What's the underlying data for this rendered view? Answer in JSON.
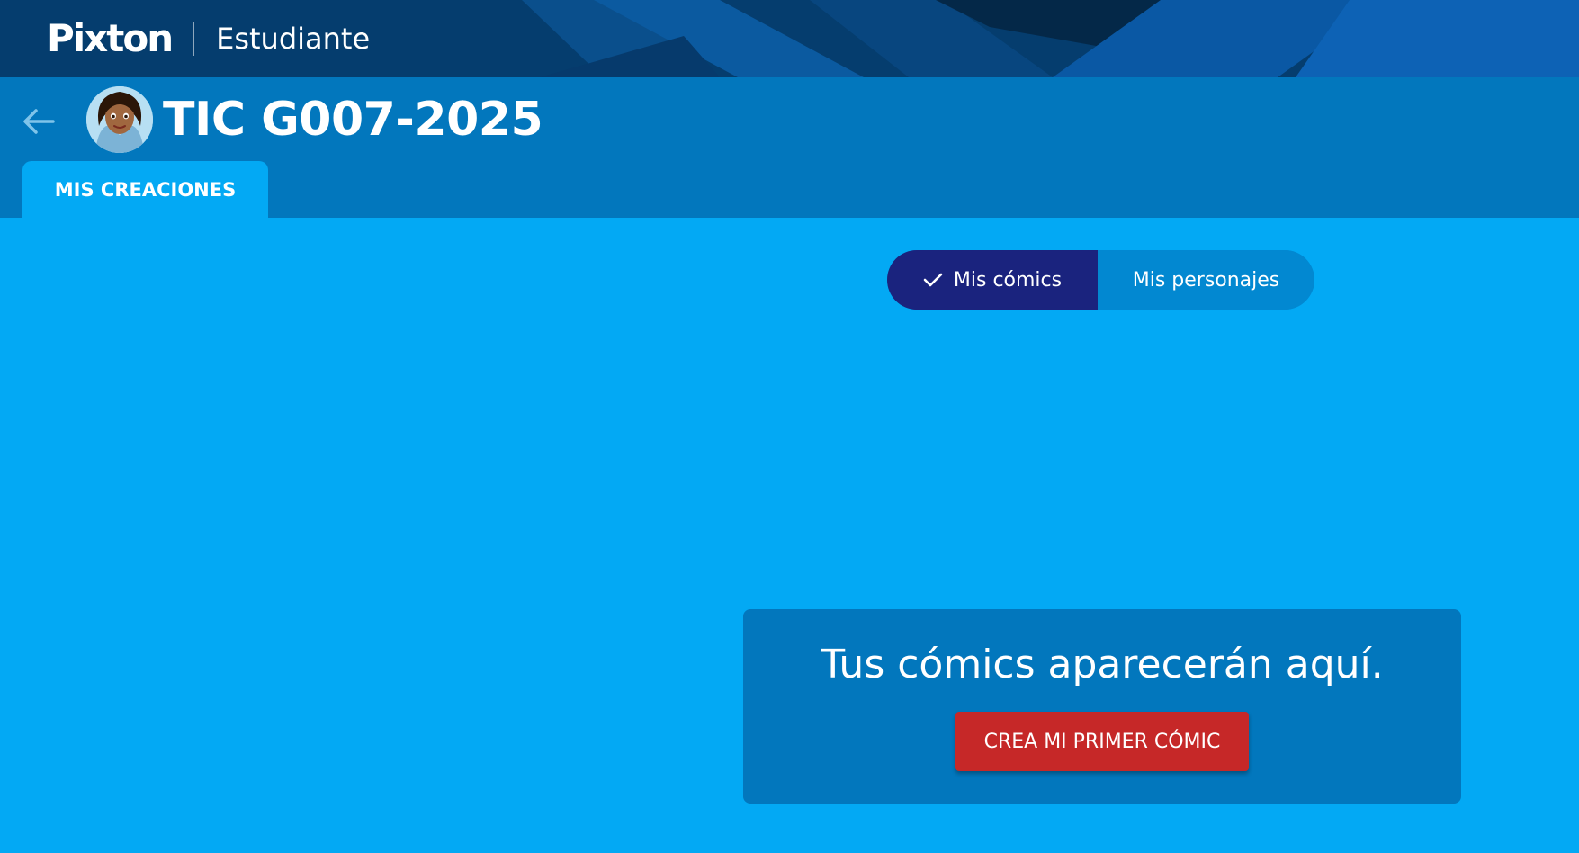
{
  "brand": {
    "logo": "Pixton",
    "role": "Estudiante"
  },
  "header": {
    "class_title": "TIC G007-2025"
  },
  "tabs": [
    {
      "label": "MIS CREACIONES",
      "active": true
    }
  ],
  "toggle": {
    "options": [
      {
        "label": "Mis cómics",
        "selected": true,
        "icon": "check-icon"
      },
      {
        "label": "Mis personajes",
        "selected": false
      }
    ]
  },
  "empty_state": {
    "message": "Tus cómics aparecerán aquí.",
    "button_label": "CREA MI PRIMER CÓMIC"
  },
  "colors": {
    "page_background": "#03a9f4",
    "brand_bar": "#053d6e",
    "class_bar": "#0277bd",
    "toggle_selected": "#1a237e",
    "primary_button": "#c62828"
  }
}
